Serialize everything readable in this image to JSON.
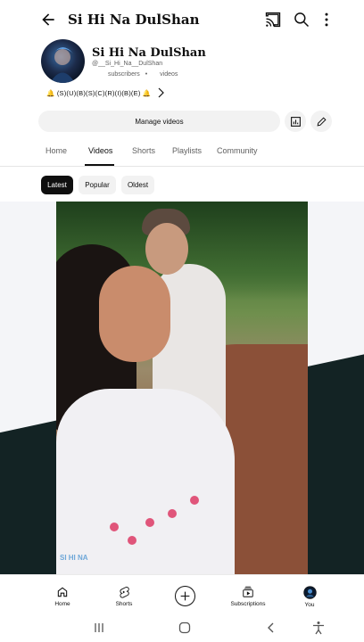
{
  "header": {
    "title": "Si Hi Na DulShan",
    "back_icon": "back-arrow-icon",
    "cast_icon": "cast-icon",
    "search_icon": "search-icon",
    "more_icon": "more-vertical-icon"
  },
  "channel": {
    "name": "Si Hi Na DulShan",
    "handle": "@__Si_Hi_Na__DulShan",
    "subscribers_label": "subscribers",
    "separator": "•",
    "videos_label": "videos",
    "description": "🔔 (S)(U)(B)(S)(C)(R)(I)(B)(E) 🔔"
  },
  "actions": {
    "manage_videos": "Manage videos",
    "analytics_icon": "analytics-icon",
    "edit_icon": "pencil-icon"
  },
  "tabs": [
    {
      "label": "Home",
      "active": false
    },
    {
      "label": "Videos",
      "active": true
    },
    {
      "label": "Shorts",
      "active": false
    },
    {
      "label": "Playlists",
      "active": false
    },
    {
      "label": "Community",
      "active": false
    }
  ],
  "filters": [
    {
      "label": "Latest",
      "selected": true
    },
    {
      "label": "Popular",
      "selected": false
    },
    {
      "label": "Oldest",
      "selected": false
    }
  ],
  "video": {
    "watermark": "SI HI NA"
  },
  "bottom_nav": [
    {
      "label": "Home",
      "icon": "home-icon"
    },
    {
      "label": "Shorts",
      "icon": "shorts-icon"
    },
    {
      "label": "",
      "icon": "create-plus-icon"
    },
    {
      "label": "Subscriptions",
      "icon": "subscriptions-icon"
    },
    {
      "label": "You",
      "icon": "profile-avatar-icon"
    }
  ],
  "system_nav": [
    "recents-icon",
    "home-circle-icon",
    "back-chevron-icon",
    "accessibility-icon"
  ],
  "colors": {
    "text_primary": "#0f0f0f",
    "text_secondary": "#606060",
    "chip_bg": "#f2f2f2",
    "active_chip_bg": "#0f0f0f",
    "video_dark_bg": "#132324"
  }
}
